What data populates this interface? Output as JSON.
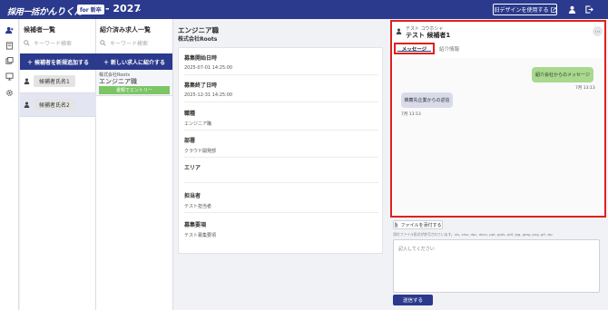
{
  "header": {
    "logo_main": "採用一括",
    "logo_accent": "かんりくん",
    "logo_badge": "for 新卒",
    "year": "- 2027",
    "old_design_label": "旧デザインを使用する"
  },
  "candidates": {
    "title": "候補者一覧",
    "search_placeholder": "キーワード検索",
    "add_button": "＋ 候補者を新規追加する",
    "items": [
      {
        "name": "候補者氏名1"
      },
      {
        "name": "候補者氏名2"
      }
    ]
  },
  "jobs": {
    "title": "紹介済み求人一覧",
    "search_placeholder": "キーワード検索",
    "add_button": "＋ 新しい求人に紹介する",
    "card": {
      "company": "株式会社Roots",
      "title": "エンジニア職",
      "status": "書類でエントリー"
    }
  },
  "detail": {
    "title": "エンジニア職",
    "company": "株式会社Roots",
    "fields": [
      {
        "label": "募集開始日時",
        "value": "2025-07-01 14:25:00"
      },
      {
        "label": "募集終了日時",
        "value": "2025-12-31 14:25:00"
      },
      {
        "label": "職種",
        "value": "エンジニア職"
      },
      {
        "label": "部署",
        "value": "クラウド開発部"
      },
      {
        "label": "エリア",
        "value": ""
      },
      {
        "label": "担当者",
        "value": "テスト担当者"
      },
      {
        "label": "募集要項",
        "value": "テスト募集要項"
      }
    ]
  },
  "messages": {
    "kana": "テスト コウホシャ",
    "name": "テスト 候補者1",
    "tabs": {
      "message": "メッセージ",
      "info": "紹介情報"
    },
    "outgoing": {
      "text": "紹介会社からのメッセージ",
      "time": "7月 13:13"
    },
    "incoming": {
      "text": "推薦先企業からの返信",
      "time": "7月 13:13"
    }
  },
  "composer": {
    "attach_label": "ファイルを添付する",
    "attach_note": "添付ファイル形式が許可されています。xls, xlsx, doc, docx, ppt, pptx, pdf, jpg, jpeg, png, gif, zip",
    "placeholder": "記入してください",
    "send_label": "送信する"
  },
  "colors": {
    "primary": "#2b3a8c",
    "highlight": "#e0201c",
    "status_green": "#7cc564",
    "bubble_out": "#a8d98e",
    "bubble_in": "#d9dbeb"
  }
}
